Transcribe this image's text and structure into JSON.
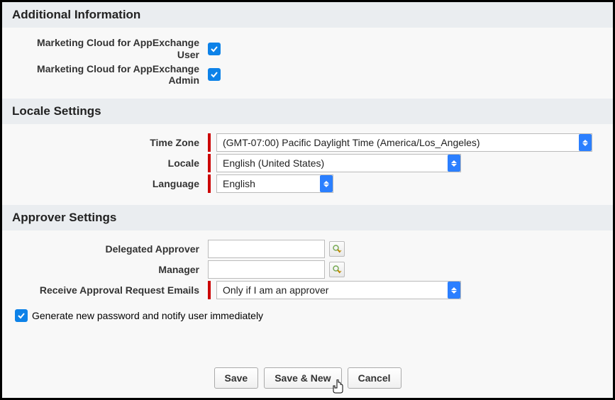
{
  "sections": {
    "additional": {
      "header": "Additional Information",
      "marketing_user_label": "Marketing Cloud for AppExchange User",
      "marketing_admin_label": "Marketing Cloud for AppExchange Admin",
      "marketing_user_checked": true,
      "marketing_admin_checked": true
    },
    "locale": {
      "header": "Locale Settings",
      "timezone_label": "Time Zone",
      "timezone_value": "(GMT-07:00) Pacific Daylight Time (America/Los_Angeles)",
      "locale_label": "Locale",
      "locale_value": "English (United States)",
      "language_label": "Language",
      "language_value": "English"
    },
    "approver": {
      "header": "Approver Settings",
      "delegated_label": "Delegated Approver",
      "delegated_value": "",
      "manager_label": "Manager",
      "manager_value": "",
      "emails_label": "Receive Approval Request Emails",
      "emails_value": "Only if I am an approver"
    }
  },
  "generate_pwd_label": "Generate new password and notify user immediately",
  "generate_pwd_checked": true,
  "buttons": {
    "save": "Save",
    "save_new": "Save & New",
    "cancel": "Cancel"
  }
}
